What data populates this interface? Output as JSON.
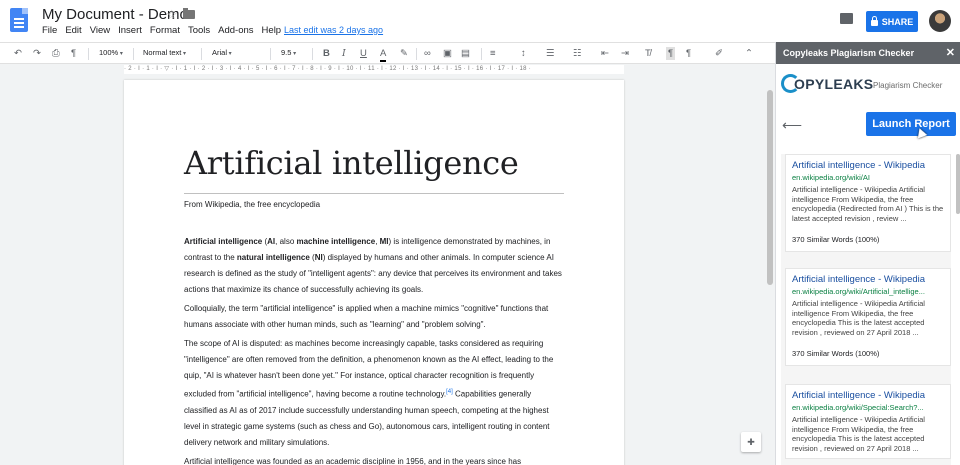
{
  "header": {
    "title": "My Document - Demo",
    "last_edit": "Last edit was 2 days ago",
    "share_label": "SHARE",
    "menu": [
      "File",
      "Edit",
      "View",
      "Insert",
      "Format",
      "Tools",
      "Add-ons",
      "Help"
    ]
  },
  "toolbar": {
    "zoom": "100%",
    "style": "Normal text",
    "font": "Arial",
    "size": "9.5"
  },
  "ruler": "· 2 · I · 1 · I · ▽ · I · 1 · I · 2 · I · 3 · I · 4 · I · 5 · I · 6 · I · 7 · I · 8 · I · 9 · I · 10 · I · 11 · I · 12 · I · 13 · I · 14 · I · 15 · I · 16 · I · 17 · I · 18 ·",
  "document": {
    "title": "Artificial intelligence",
    "subtitle": "From Wikipedia, the free encyclopedia",
    "p1": {
      "t1": "Artificial intelligence",
      "t2": " (",
      "t3": "AI",
      "t4": ", also ",
      "t5": "machine intelligence",
      "t6": ", ",
      "t7": "MI",
      "t8": ") is intelligence demonstrated by machines, in contrast to the ",
      "t9": "natural intelligence",
      "t10": " (",
      "t11": "NI",
      "t12": ") displayed by humans and other animals. In computer science AI research is defined as the study of \"intelligent agents\": any device that perceives its environment and takes actions that maximize its chance of successfully achieving its goals."
    },
    "p2": "Colloquially, the term \"artificial intelligence\" is applied when a machine mimics \"cognitive\" functions that humans associate with other human minds, such as \"learning\" and \"problem solving\".",
    "p3": {
      "a": "The scope of AI is disputed: as machines become increasingly capable, tasks considered as requiring \"intelligence\" are often removed from the definition, a phenomenon known as the AI effect, leading to the quip, \"AI is whatever hasn't been done yet.\" For instance, optical character recognition is frequently excluded from \"artificial intelligence\", having become a routine technology.",
      "cite": "[4]",
      "b": " Capabilities generally classified as AI as of 2017 include successfully understanding human speech, competing at the highest level in strategic game systems (such as chess and Go), autonomous cars, intelligent routing in content delivery network and military simulations."
    },
    "p4": "Artificial intelligence was founded as an academic discipline in 1956, and in the years since has"
  },
  "panel": {
    "header": "Copyleaks Plagiarism Checker",
    "logo_text": "OPYLEAKS",
    "logo_sub": "Plagiarism Checker",
    "launch_label": "Launch Report",
    "results": [
      {
        "title": "Artificial intelligence - Wikipedia",
        "url": "en.wikipedia.org/wiki/AI",
        "snippet": "Artificial intelligence - Wikipedia Artificial intelligence From Wikipedia, the free encyclopedia (Redirected from AI ) This is the latest accepted revision , review ...",
        "count": "370 Similar Words (100%)"
      },
      {
        "title": "Artificial intelligence - Wikipedia",
        "url": "en.wikipedia.org/wiki/Artificial_intellige...",
        "snippet": "Artificial intelligence - Wikipedia Artificial intelligence From Wikipedia, the free encyclopedia This is the latest accepted revision , reviewed on 27 April 2018 ...",
        "count": "370 Similar Words (100%)"
      },
      {
        "title": "Artificial intelligence - Wikipedia",
        "url": "en.wikipedia.org/wiki/Special:Search?...",
        "snippet": "Artificial intelligence - Wikipedia Artificial intelligence From Wikipedia, the free encyclopedia This is the latest accepted revision , reviewed on 27 April 2018 ...",
        "count": ""
      }
    ]
  },
  "colors": {
    "accent": "#1a73e8",
    "panel_header": "#5f6368",
    "link": "#1a4fa0",
    "url": "#0b8043"
  }
}
